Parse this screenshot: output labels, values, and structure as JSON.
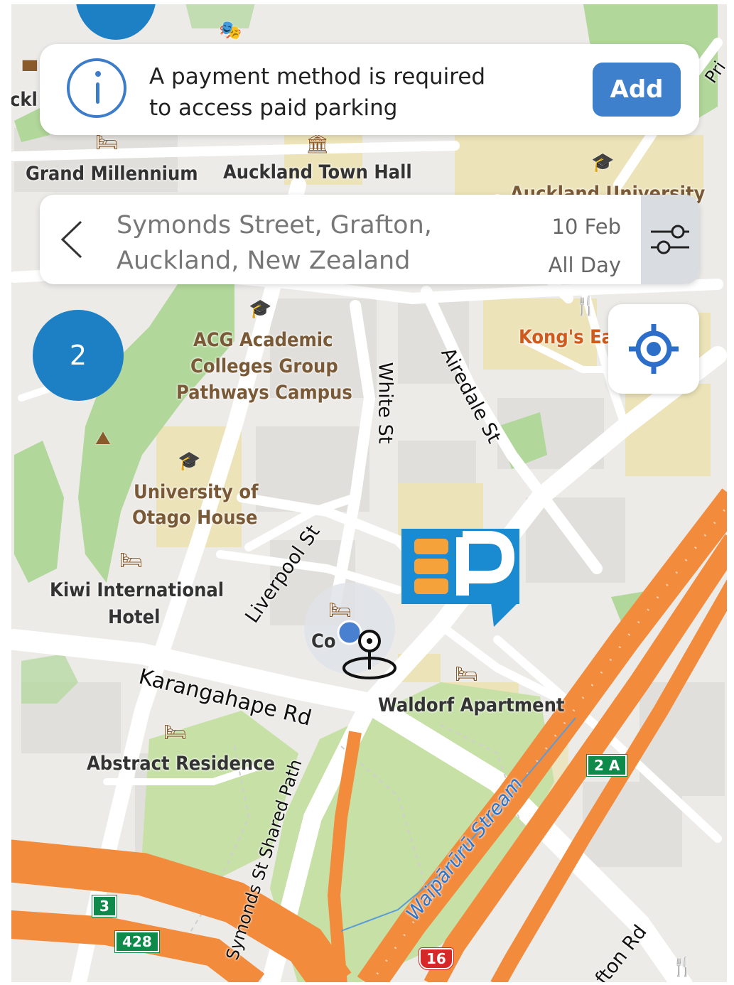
{
  "banner": {
    "message_line1": "A payment method is required",
    "message_line2": "to access paid parking",
    "add_label": "Add"
  },
  "search": {
    "address_line1": "Symonds Street, Grafton,",
    "address_line2": "Auckland, New Zealand",
    "date": "10 Feb",
    "duration": "All Day"
  },
  "map": {
    "clusters": [
      {
        "count": "2"
      }
    ],
    "labels": {
      "grand_millennium": "Grand Millennium",
      "town_hall": "Auckland Town Hall",
      "auckland_university": "Auckland University",
      "acg_1": "ACG Academic",
      "acg_2": "Colleges Group",
      "acg_3": "Pathways Campus",
      "kongs": "Kong's Ea",
      "otago_1": "University of",
      "otago_2": "Otago House",
      "kiwi_1": "Kiwi International",
      "kiwi_2": "Hotel",
      "waldorf": "Waldorf Apartment",
      "abstract": "Abstract Residence",
      "ckl": "ckl",
      "co": "Co"
    },
    "streets": {
      "white_st": "White St",
      "airedale_st": "Airedale St",
      "liverpool_st": "Liverpool St",
      "karangahape_rd": "Karangahape Rd",
      "symonds_path": "Symonds St Shared Path",
      "waiparuru": "Waipārūrū Stream",
      "grafton_rd": "afton Rd",
      "pri": "Pri"
    },
    "route_shields": {
      "r2a": "2 A",
      "r3": "3",
      "r428": "428",
      "r16": "16"
    }
  },
  "colors": {
    "accent_blue": "#3f80cd",
    "cluster_blue": "#1d7fc4",
    "motorway_orange": "#f28b3c",
    "park_green": "#a6d48a",
    "campus_tan": "#e8ddb0"
  }
}
